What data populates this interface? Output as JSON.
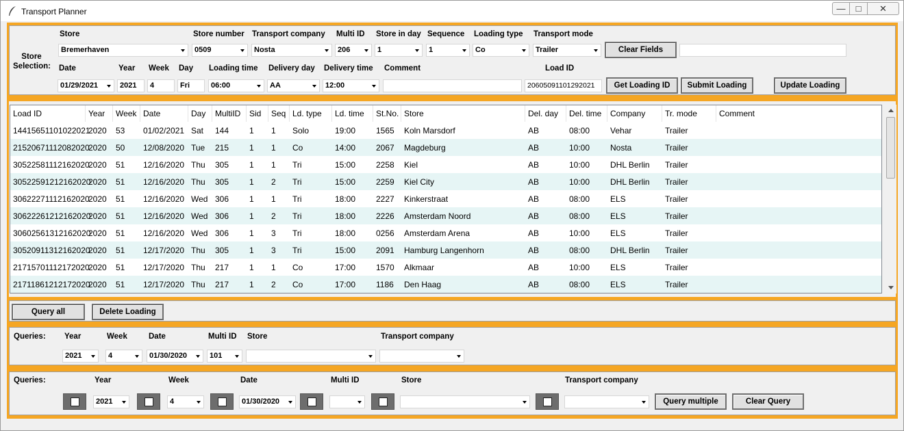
{
  "window": {
    "title": "Transport Planner",
    "minimize": "—",
    "maximize": "□",
    "close": "✕"
  },
  "store_selection": {
    "section_label": "Store Selection:",
    "labels": {
      "store": "Store",
      "store_number": "Store number",
      "transport_company": "Transport company",
      "multi_id": "Multi ID",
      "store_in_day": "Store in day",
      "sequence": "Sequence",
      "loading_type": "Loading type",
      "transport_mode": "Transport mode",
      "date": "Date",
      "year": "Year",
      "week": "Week",
      "day": "Day",
      "loading_time": "Loading time",
      "delivery_day": "Delivery day",
      "delivery_time": "Delivery time",
      "comment": "Comment",
      "load_id": "Load ID"
    },
    "values": {
      "store": "Bremerhaven",
      "store_number": "0509",
      "transport_company": "Nosta",
      "multi_id": "206",
      "store_in_day": "1",
      "sequence": "1",
      "loading_type": "Co",
      "transport_mode": "Trailer",
      "extra_field": "",
      "date": "01/29/2021",
      "year": "2021",
      "week": "4",
      "day": "Fri",
      "loading_time": "06:00",
      "delivery_day": "AA",
      "delivery_time": "12:00",
      "comment": "",
      "load_id": "20605091101292021"
    },
    "buttons": {
      "clear_fields": "Clear Fields",
      "get_loading_id": "Get Loading ID",
      "submit_loading": "Submit Loading",
      "update_loading": "Update Loading"
    }
  },
  "table": {
    "columns": [
      "Load ID",
      "Year",
      "Week",
      "Date",
      "Day",
      "MultiID",
      "Sid",
      "Seq",
      "Ld. type",
      "Ld. time",
      "St.No.",
      "Store",
      "Del. day",
      "Del. time",
      "Company",
      "Tr. mode",
      "Comment"
    ],
    "rows": [
      [
        "14415651101022021",
        "2020",
        "53",
        "01/02/2021",
        "Sat",
        "144",
        "1",
        "1",
        "Solo",
        "19:00",
        "1565",
        "Koln Marsdorf",
        "AB",
        "08:00",
        "Vehar",
        "Trailer",
        ""
      ],
      [
        "21520671112082020",
        "2020",
        "50",
        "12/08/2020",
        "Tue",
        "215",
        "1",
        "1",
        "Co",
        "14:00",
        "2067",
        "Magdeburg",
        "AB",
        "10:00",
        "Nosta",
        "Trailer",
        ""
      ],
      [
        "30522581112162020",
        "2020",
        "51",
        "12/16/2020",
        "Thu",
        "305",
        "1",
        "1",
        "Tri",
        "15:00",
        "2258",
        "Kiel",
        "AB",
        "10:00",
        "DHL Berlin",
        "Trailer",
        ""
      ],
      [
        "30522591212162020",
        "2020",
        "51",
        "12/16/2020",
        "Thu",
        "305",
        "1",
        "2",
        "Tri",
        "15:00",
        "2259",
        "Kiel City",
        "AB",
        "10:00",
        "DHL Berlin",
        "Trailer",
        ""
      ],
      [
        "30622271112162020",
        "2020",
        "51",
        "12/16/2020",
        "Wed",
        "306",
        "1",
        "1",
        "Tri",
        "18:00",
        "2227",
        "Kinkerstraat",
        "AB",
        "08:00",
        "ELS",
        "Trailer",
        ""
      ],
      [
        "30622261212162020",
        "2020",
        "51",
        "12/16/2020",
        "Wed",
        "306",
        "1",
        "2",
        "Tri",
        "18:00",
        "2226",
        "Amsterdam Noord",
        "AB",
        "08:00",
        "ELS",
        "Trailer",
        ""
      ],
      [
        "30602561312162020",
        "2020",
        "51",
        "12/16/2020",
        "Wed",
        "306",
        "1",
        "3",
        "Tri",
        "18:00",
        "0256",
        "Amsterdam Arena",
        "AB",
        "10:00",
        "ELS",
        "Trailer",
        ""
      ],
      [
        "30520911312162020",
        "2020",
        "51",
        "12/17/2020",
        "Thu",
        "305",
        "1",
        "3",
        "Tri",
        "15:00",
        "2091",
        "Hamburg Langenhorn",
        "AB",
        "08:00",
        "DHL Berlin",
        "Trailer",
        ""
      ],
      [
        "21715701112172020",
        "2020",
        "51",
        "12/17/2020",
        "Thu",
        "217",
        "1",
        "1",
        "Co",
        "17:00",
        "1570",
        "Alkmaar",
        "AB",
        "10:00",
        "ELS",
        "Trailer",
        ""
      ],
      [
        "21711861212172020",
        "2020",
        "51",
        "12/17/2020",
        "Thu",
        "217",
        "1",
        "2",
        "Co",
        "17:00",
        "1186",
        "Den Haag",
        "AB",
        "08:00",
        "ELS",
        "Trailer",
        ""
      ]
    ]
  },
  "actions": {
    "query_all": "Query all",
    "delete_loading": "Delete Loading"
  },
  "queries1": {
    "label": "Queries:",
    "labels": {
      "year": "Year",
      "week": "Week",
      "date": "Date",
      "multi_id": "Multi ID",
      "store": "Store",
      "transport_company": "Transport company"
    },
    "values": {
      "year": "2021",
      "week": "4",
      "date": "01/30/2020",
      "multi_id": "101",
      "store": "",
      "transport_company": ""
    }
  },
  "queries2": {
    "label": "Queries:",
    "labels": {
      "year": "Year",
      "week": "Week",
      "date": "Date",
      "multi_id": "Multi ID",
      "store": "Store",
      "transport_company": "Transport company"
    },
    "values": {
      "year": "2021",
      "week": "4",
      "date": "01/30/2020",
      "multi_id": "",
      "store": "",
      "transport_company": ""
    },
    "buttons": {
      "query_multiple": "Query multiple",
      "clear_query": "Clear Query"
    }
  },
  "colors": {
    "accent": "#f5a623",
    "row_alt": "#e6f5f5",
    "panel": "#f0f0f0"
  }
}
